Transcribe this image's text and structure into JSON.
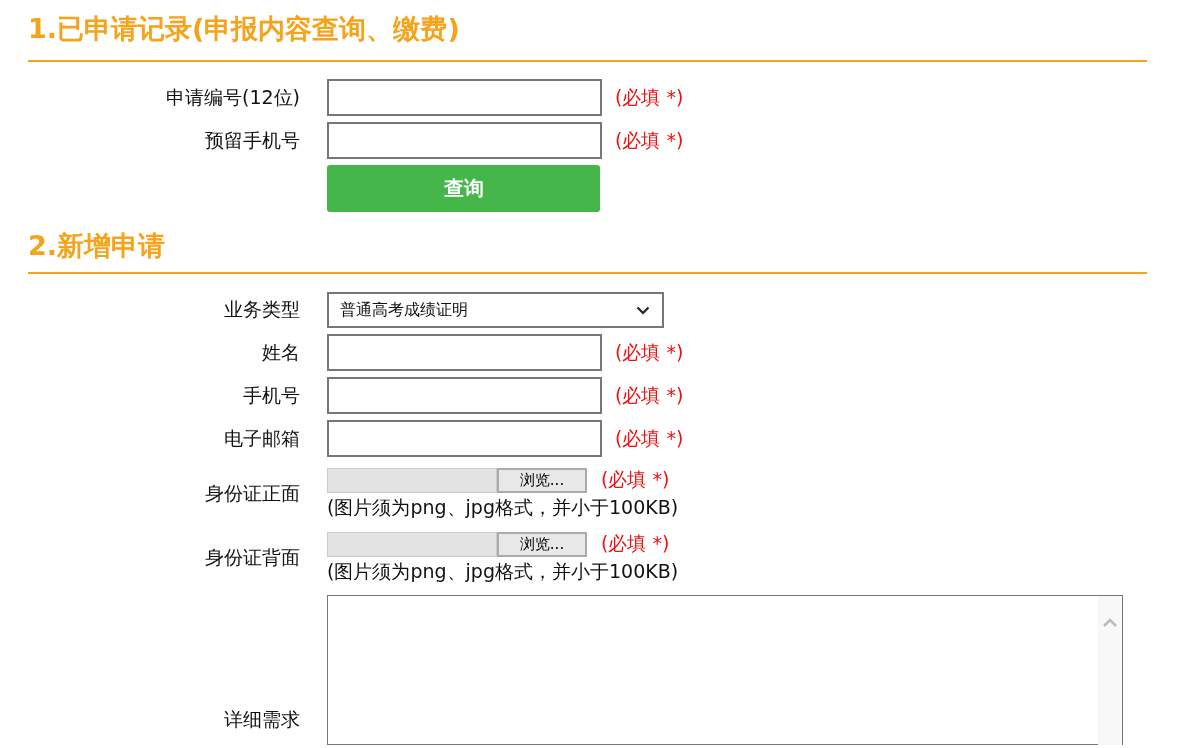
{
  "sections": [
    {
      "title": "1.已申请记录(申报内容查询、缴费)",
      "fields": [
        {
          "kind": "text",
          "label": "申请编号(12位)",
          "note": "(必填 *)"
        },
        {
          "kind": "text",
          "label": "预留手机号",
          "note": "(必填 *)"
        }
      ],
      "button": "查询"
    },
    {
      "title": "2.新增申请",
      "fields": [
        {
          "kind": "select",
          "label": "业务类型",
          "value": "普通高考成绩证明"
        },
        {
          "kind": "text",
          "label": "姓名",
          "note": "(必填 *)"
        },
        {
          "kind": "text",
          "label": "手机号",
          "note": "(必填 *)"
        },
        {
          "kind": "text",
          "label": "电子邮箱",
          "note": "(必填 *)"
        },
        {
          "kind": "file",
          "label": "身份证正面",
          "button": "浏览...",
          "note": "(必填 *)",
          "hint": "(图片须为png、jpg格式，并小于100KB)"
        },
        {
          "kind": "file",
          "label": "身份证背面",
          "button": "浏览...",
          "note": "(必填 *)",
          "hint": "(图片须为png、jpg格式，并小于100KB)"
        },
        {
          "kind": "textarea",
          "label": "详细需求"
        }
      ]
    }
  ]
}
